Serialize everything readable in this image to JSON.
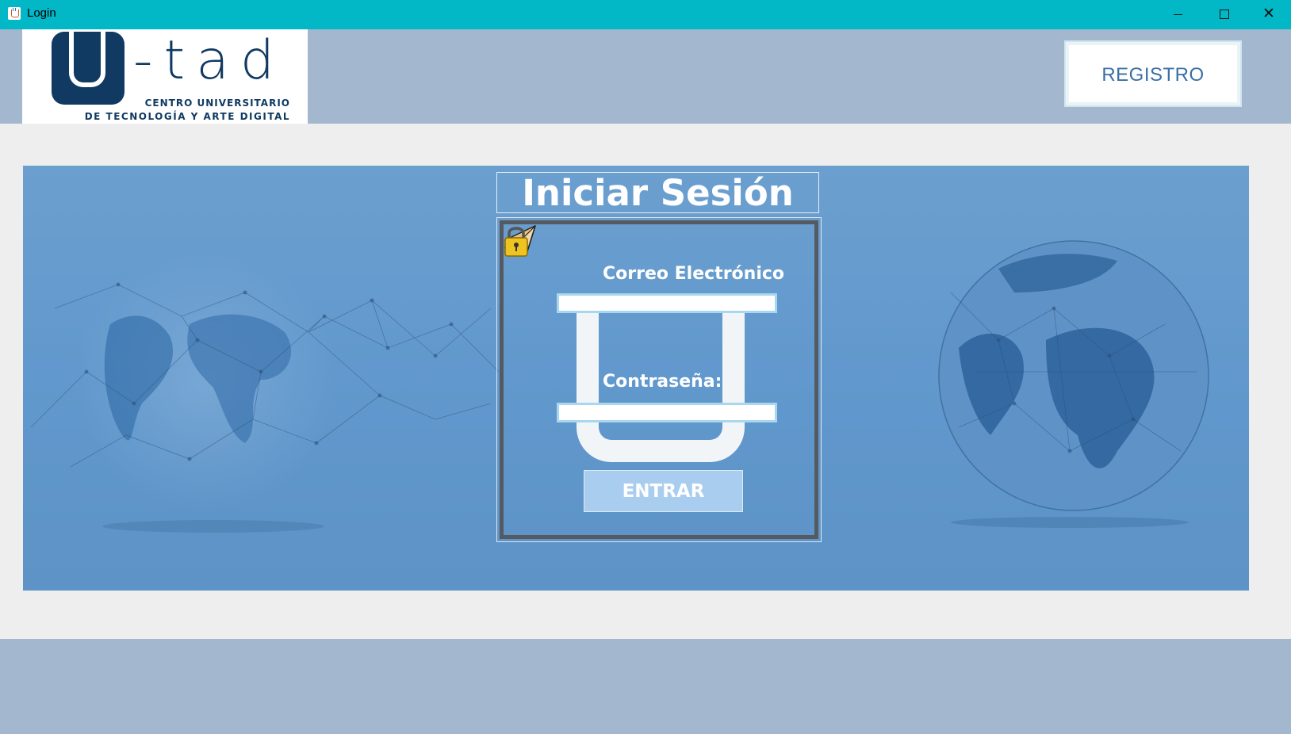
{
  "window": {
    "title": "Login",
    "controls": {
      "minimize": "minimize",
      "maximize": "maximize",
      "close": "✕"
    }
  },
  "header": {
    "logo": {
      "word": "U-tad",
      "line1": "CENTRO UNIVERSITARIO",
      "line2": "DE TECNOLOGÍA Y ARTE DIGITAL"
    },
    "register_button": "REGISTRO"
  },
  "login": {
    "title": "Iniciar Sesión",
    "email_label": "Correo Electrónico",
    "email_value": "",
    "password_label": "Contraseña:",
    "password_value": "",
    "submit_label": "ENTRAR"
  },
  "colors": {
    "titlebar": "#02b8c6",
    "header": "#a3b7cf",
    "banner": "#6198cd",
    "brand_navy": "#103a62",
    "button": "#a9cdee"
  },
  "icons": [
    "java-app-icon",
    "paper-plane-icon",
    "padlock-icon"
  ]
}
